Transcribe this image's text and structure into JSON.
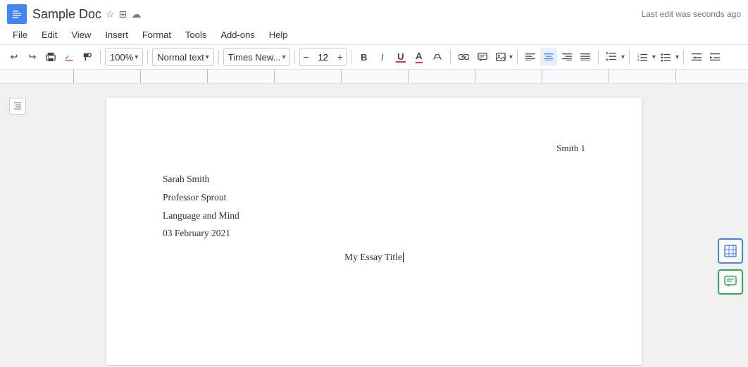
{
  "titlebar": {
    "doc_icon": "D",
    "doc_title": "Sample Doc",
    "star_icon": "☆",
    "folder_icon": "⊞",
    "cloud_icon": "☁",
    "last_edit": "Last edit was seconds ago"
  },
  "menubar": {
    "items": [
      "File",
      "Edit",
      "View",
      "Insert",
      "Format",
      "Tools",
      "Add-ons",
      "Help"
    ]
  },
  "toolbar": {
    "undo": "↩",
    "redo": "↪",
    "print": "🖨",
    "spell": "✓",
    "paint": "▶",
    "zoom": "100%",
    "style": "Normal text",
    "font": "Times New...",
    "font_decrease": "−",
    "font_size": "12",
    "font_increase": "+",
    "bold": "B",
    "italic": "I",
    "underline": "U",
    "text_color": "A",
    "highlight": "✎",
    "link": "🔗",
    "comment": "💬",
    "image": "⊞",
    "align_left": "≡",
    "align_center": "≡",
    "align_right": "≡",
    "align_justify": "≡",
    "line_spacing": "↕",
    "numbered_list": "≡",
    "bullet_list": "≡",
    "indent_decrease": "⇐",
    "indent_increase": "⇒"
  },
  "page": {
    "header_right": "Smith 1",
    "line1": "Sarah Smith",
    "line2": "Professor Sprout",
    "line3": "Language and Mind",
    "line4": "03 February 2021",
    "title": "My Essay Title"
  },
  "action_buttons": {
    "add": "+",
    "comment": "✎"
  }
}
